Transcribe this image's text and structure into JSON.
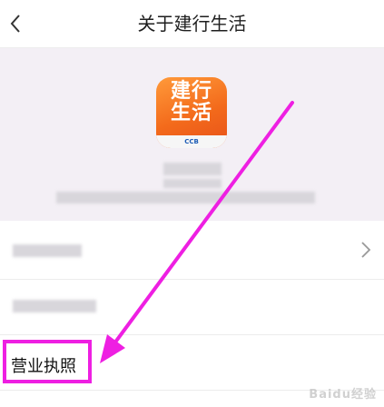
{
  "nav": {
    "title": "关于建行生活",
    "back_icon": "chevron-left-icon"
  },
  "app": {
    "logo_text_line1": "建行",
    "logo_text_line2": "生活",
    "logo_brand": "CCB",
    "logo_color": "#f36a1b"
  },
  "list": {
    "row3_label": "营业执照"
  },
  "annotation": {
    "highlight_color": "#ee1fe2"
  },
  "watermark": "Baidu经验"
}
